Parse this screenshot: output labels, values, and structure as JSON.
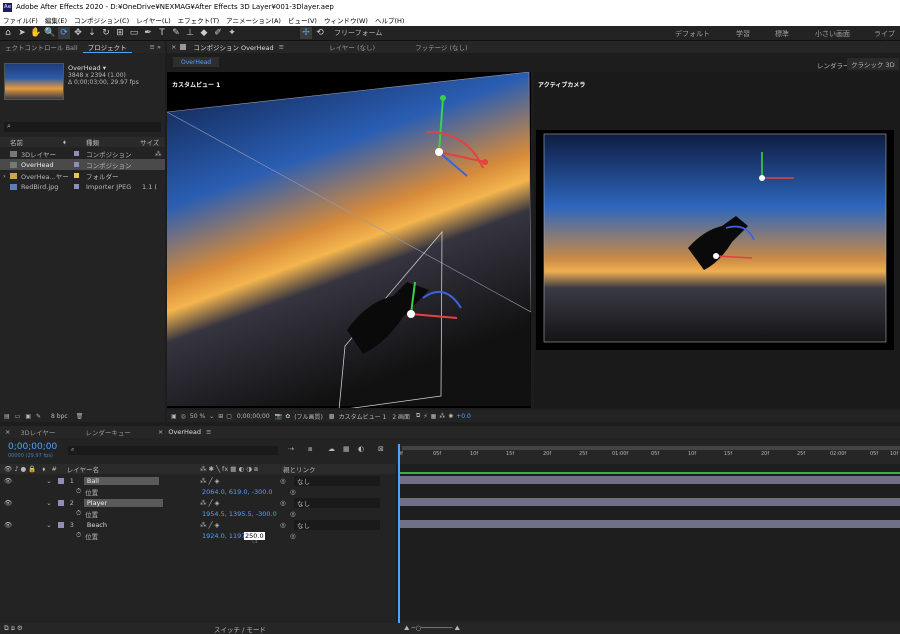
{
  "window": {
    "title": "Adobe After Effects 2020 - D:¥OneDrive¥NEXMAG¥After Effects 3D Layer¥001-3Dlayer.aep"
  },
  "menu": [
    "ファイル(F)",
    "編集(E)",
    "コンポジション(C)",
    "レイヤー(L)",
    "エフェクト(T)",
    "アニメーション(A)",
    "ビュー(V)",
    "ウィンドウ(W)",
    "ヘルプ(H)"
  ],
  "toolbar": {
    "freeform": "フリーフォーム",
    "workspaces": [
      "デフォルト",
      "学習",
      "標準",
      "小さい画面",
      "ライブラリ"
    ]
  },
  "project": {
    "tabs": [
      "ェクトコントロール Ball",
      "プロジェクト"
    ],
    "thumb_name": "OverHead ▾",
    "thumb_info1": "3848 x 2394 (1.00)",
    "thumb_info2": "Δ 0;00;03;00, 29.97 fps",
    "search_placeholder": "",
    "cols": [
      "名前",
      "種類",
      "サイズ"
    ],
    "items": [
      {
        "name": "3Dレイヤー",
        "type": "コンポジション",
        "size": "",
        "color": "#8d8fb8"
      },
      {
        "name": "OverHead",
        "type": "コンポジション",
        "size": "",
        "color": "#8d8fb8"
      },
      {
        "name": "OverHea...ヤー",
        "type": "フォルダー",
        "size": "",
        "color": "#e6c84a"
      },
      {
        "name": "RedBird.jpg",
        "type": "Importer JPEG",
        "size": "1.1 (",
        "color": "#8d8fb8"
      }
    ],
    "bpc": "8 bpc"
  },
  "comp": {
    "tabs": [
      "コンポジション OverHead",
      "レイヤー (なし)",
      "フッテージ (なし)"
    ],
    "subtab": "OverHead",
    "renderer_label": "レンダラー：",
    "renderer": "クラシック 3D",
    "left_view": "カスタムビュー 1",
    "right_view": "アクティブカメラ",
    "footer": {
      "zoom": "50 %",
      "time": "0;00;00;00",
      "res": "(フル画質)",
      "view": "カスタムビュー 1",
      "layout": "2 画面",
      "exposure": "+0.0"
    }
  },
  "timeline": {
    "tabs": [
      "3Dレイヤー",
      "レンダーキュー",
      "OverHead"
    ],
    "timecode": "0;00;00;00",
    "fps": "00000 (29.97 fps)",
    "col_layer": "レイヤー名",
    "col_parent": "親とリンク",
    "ruler": [
      "0f",
      "05f",
      "10f",
      "15f",
      "20f",
      "25f",
      "01:00f",
      "05f",
      "10f",
      "15f",
      "20f",
      "25f",
      "02:00f",
      "05f",
      "10f"
    ],
    "layers": [
      {
        "num": "1",
        "name": "Ball",
        "parent": "なし",
        "prop": "位置",
        "value": "2064.0, 619.0, -300.0"
      },
      {
        "num": "2",
        "name": "Player",
        "parent": "なし",
        "prop": "位置",
        "value": "1954.5, 1395.5, -300.0"
      },
      {
        "num": "3",
        "name": "Beach",
        "parent": "なし",
        "prop": "位置",
        "value": "1924.0, 1197.0,",
        "value_edit": "250.0"
      }
    ],
    "switch_mode": "スイッチ / モード"
  }
}
